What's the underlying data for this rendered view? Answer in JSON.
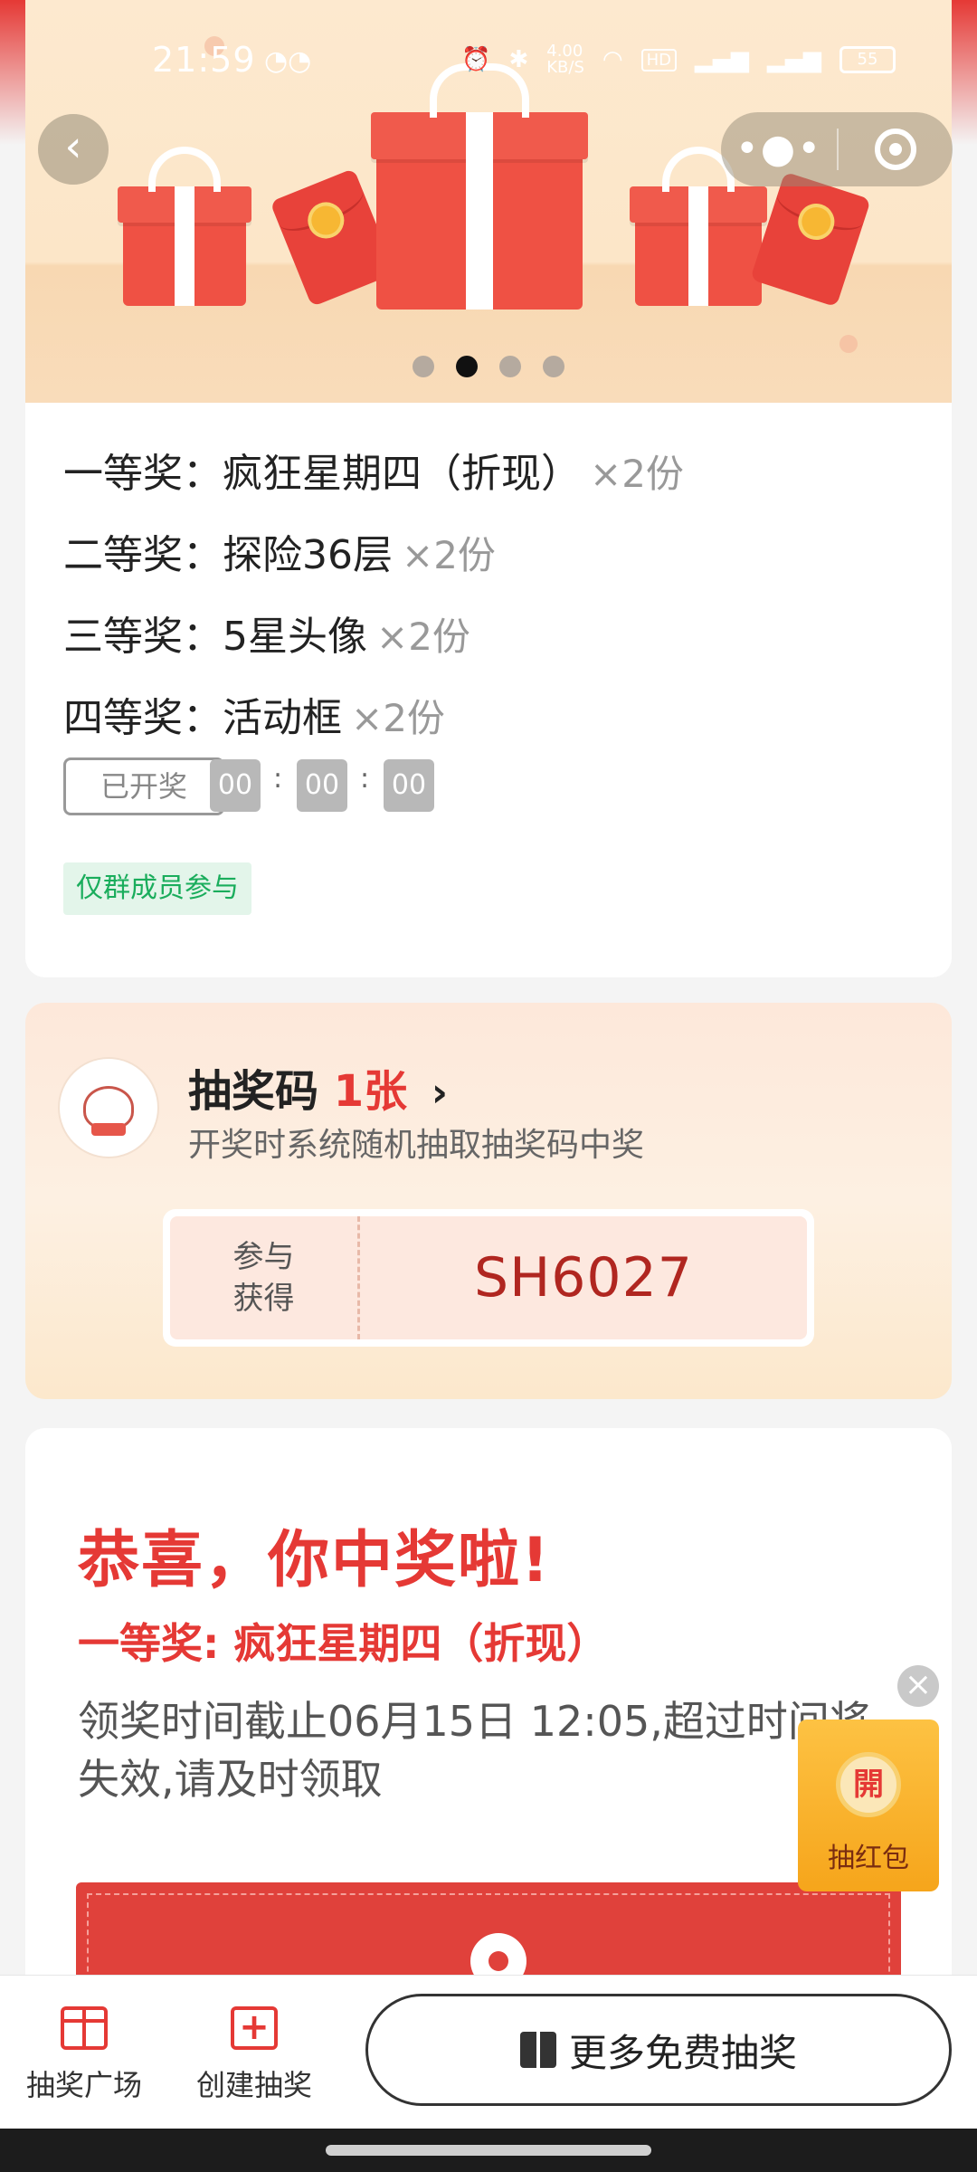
{
  "status_bar": {
    "time": "21:59",
    "speed": "4.00\nKB/S",
    "hd_label": "HD",
    "battery": "55"
  },
  "banner": {
    "pages": 4,
    "active_page": 2
  },
  "prizes": [
    {
      "rank": "一等奖：",
      "name": "疯狂星期四（折现）",
      "qty": "×2份"
    },
    {
      "rank": "二等奖：",
      "name": "探险36层",
      "qty": "×2份"
    },
    {
      "rank": "三等奖：",
      "name": "5星头像",
      "qty": "×2份"
    },
    {
      "rank": "四等奖：",
      "name": "活动框",
      "qty": "×2份"
    }
  ],
  "draw_status": "已开奖",
  "countdown": {
    "h": "00",
    "m": "00",
    "s": "00",
    "sep": ":"
  },
  "member_tag": "仅群成员参与",
  "code_section": {
    "title_prefix": "抽奖码",
    "count": "1张",
    "subtitle": "开奖时系统随机抽取抽奖码中奖",
    "ticket_label_1": "参与",
    "ticket_label_2": "获得",
    "ticket_code": "SH6027"
  },
  "win_section": {
    "title": "恭喜，你中奖啦!",
    "prize": "一等奖: 疯狂星期四（折现）",
    "note": "领奖时间截止06月15日 12:05,超过时间将失效,请及时领取"
  },
  "float_packet": {
    "coin": "開",
    "label": "抽红包"
  },
  "tabbar": {
    "plaza": "抽奖广场",
    "create": "创建抽奖",
    "more": "更多免费抽奖"
  },
  "colors": {
    "accent": "#e53935",
    "member_green": "#1aad5c",
    "packet_gold": "#f6a51b"
  }
}
